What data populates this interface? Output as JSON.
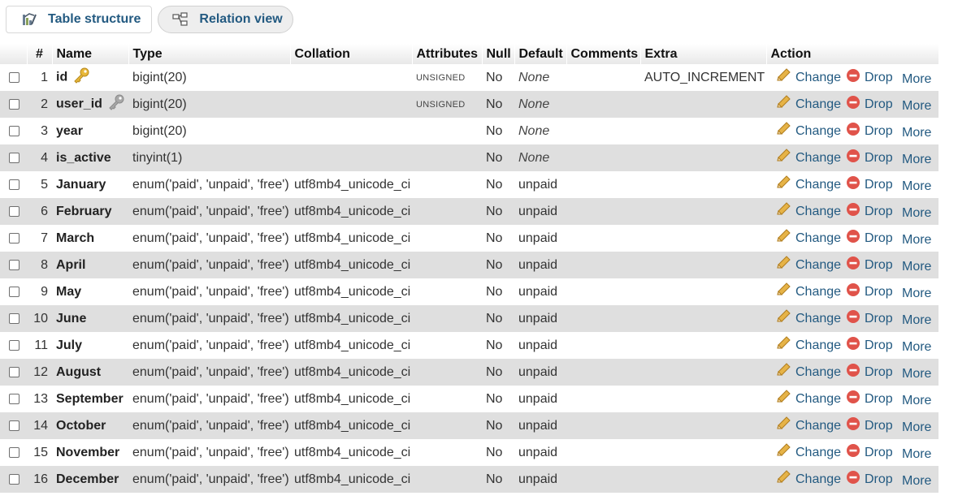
{
  "tabs": {
    "structure_label": "Table structure",
    "relation_label": "Relation view"
  },
  "columns": {
    "num": "#",
    "name": "Name",
    "type": "Type",
    "collation": "Collation",
    "attributes": "Attributes",
    "null": "Null",
    "default": "Default",
    "comments": "Comments",
    "extra": "Extra",
    "action": "Action"
  },
  "actions": {
    "change": "Change",
    "drop": "Drop",
    "more": "More"
  },
  "rows": [
    {
      "num": "1",
      "name": "id",
      "key": "primary",
      "type": "bigint(20)",
      "collation": "",
      "attributes": "UNSIGNED",
      "null": "No",
      "default": "None",
      "default_italic": true,
      "comments": "",
      "extra": "AUTO_INCREMENT"
    },
    {
      "num": "2",
      "name": "user_id",
      "key": "index",
      "type": "bigint(20)",
      "collation": "",
      "attributes": "UNSIGNED",
      "null": "No",
      "default": "None",
      "default_italic": true,
      "comments": "",
      "extra": ""
    },
    {
      "num": "3",
      "name": "year",
      "key": "",
      "type": "bigint(20)",
      "collation": "",
      "attributes": "",
      "null": "No",
      "default": "None",
      "default_italic": true,
      "comments": "",
      "extra": ""
    },
    {
      "num": "4",
      "name": "is_active",
      "key": "",
      "type": "tinyint(1)",
      "collation": "",
      "attributes": "",
      "null": "No",
      "default": "None",
      "default_italic": true,
      "comments": "",
      "extra": ""
    },
    {
      "num": "5",
      "name": "January",
      "key": "",
      "type": "enum('paid', 'unpaid', 'free')",
      "collation": "utf8mb4_unicode_ci",
      "attributes": "",
      "null": "No",
      "default": "unpaid",
      "default_italic": false,
      "comments": "",
      "extra": ""
    },
    {
      "num": "6",
      "name": "February",
      "key": "",
      "type": "enum('paid', 'unpaid', 'free')",
      "collation": "utf8mb4_unicode_ci",
      "attributes": "",
      "null": "No",
      "default": "unpaid",
      "default_italic": false,
      "comments": "",
      "extra": ""
    },
    {
      "num": "7",
      "name": "March",
      "key": "",
      "type": "enum('paid', 'unpaid', 'free')",
      "collation": "utf8mb4_unicode_ci",
      "attributes": "",
      "null": "No",
      "default": "unpaid",
      "default_italic": false,
      "comments": "",
      "extra": ""
    },
    {
      "num": "8",
      "name": "April",
      "key": "",
      "type": "enum('paid', 'unpaid', 'free')",
      "collation": "utf8mb4_unicode_ci",
      "attributes": "",
      "null": "No",
      "default": "unpaid",
      "default_italic": false,
      "comments": "",
      "extra": ""
    },
    {
      "num": "9",
      "name": "May",
      "key": "",
      "type": "enum('paid', 'unpaid', 'free')",
      "collation": "utf8mb4_unicode_ci",
      "attributes": "",
      "null": "No",
      "default": "unpaid",
      "default_italic": false,
      "comments": "",
      "extra": ""
    },
    {
      "num": "10",
      "name": "June",
      "key": "",
      "type": "enum('paid', 'unpaid', 'free')",
      "collation": "utf8mb4_unicode_ci",
      "attributes": "",
      "null": "No",
      "default": "unpaid",
      "default_italic": false,
      "comments": "",
      "extra": ""
    },
    {
      "num": "11",
      "name": "July",
      "key": "",
      "type": "enum('paid', 'unpaid', 'free')",
      "collation": "utf8mb4_unicode_ci",
      "attributes": "",
      "null": "No",
      "default": "unpaid",
      "default_italic": false,
      "comments": "",
      "extra": ""
    },
    {
      "num": "12",
      "name": "August",
      "key": "",
      "type": "enum('paid', 'unpaid', 'free')",
      "collation": "utf8mb4_unicode_ci",
      "attributes": "",
      "null": "No",
      "default": "unpaid",
      "default_italic": false,
      "comments": "",
      "extra": ""
    },
    {
      "num": "13",
      "name": "September",
      "key": "",
      "type": "enum('paid', 'unpaid', 'free')",
      "collation": "utf8mb4_unicode_ci",
      "attributes": "",
      "null": "No",
      "default": "unpaid",
      "default_italic": false,
      "comments": "",
      "extra": ""
    },
    {
      "num": "14",
      "name": "October",
      "key": "",
      "type": "enum('paid', 'unpaid', 'free')",
      "collation": "utf8mb4_unicode_ci",
      "attributes": "",
      "null": "No",
      "default": "unpaid",
      "default_italic": false,
      "comments": "",
      "extra": ""
    },
    {
      "num": "15",
      "name": "November",
      "key": "",
      "type": "enum('paid', 'unpaid', 'free')",
      "collation": "utf8mb4_unicode_ci",
      "attributes": "",
      "null": "No",
      "default": "unpaid",
      "default_italic": false,
      "comments": "",
      "extra": ""
    },
    {
      "num": "16",
      "name": "December",
      "key": "",
      "type": "enum('paid', 'unpaid', 'free')",
      "collation": "utf8mb4_unicode_ci",
      "attributes": "",
      "null": "No",
      "default": "unpaid",
      "default_italic": false,
      "comments": "",
      "extra": ""
    }
  ],
  "colors": {
    "link": "#235a81",
    "row_alt": "#dfdfdf",
    "primary_key_icon": "#e8b83a",
    "index_key_icon": "#a8a8a8",
    "drop_icon": "#e0534a",
    "change_icon": "#e6b347"
  },
  "icons": {
    "structure": "table-structure-icon",
    "relation": "relation-view-icon",
    "primary_key": "primary-key-icon",
    "index_key": "index-key-icon",
    "change": "pencil-icon",
    "drop": "drop-icon"
  }
}
